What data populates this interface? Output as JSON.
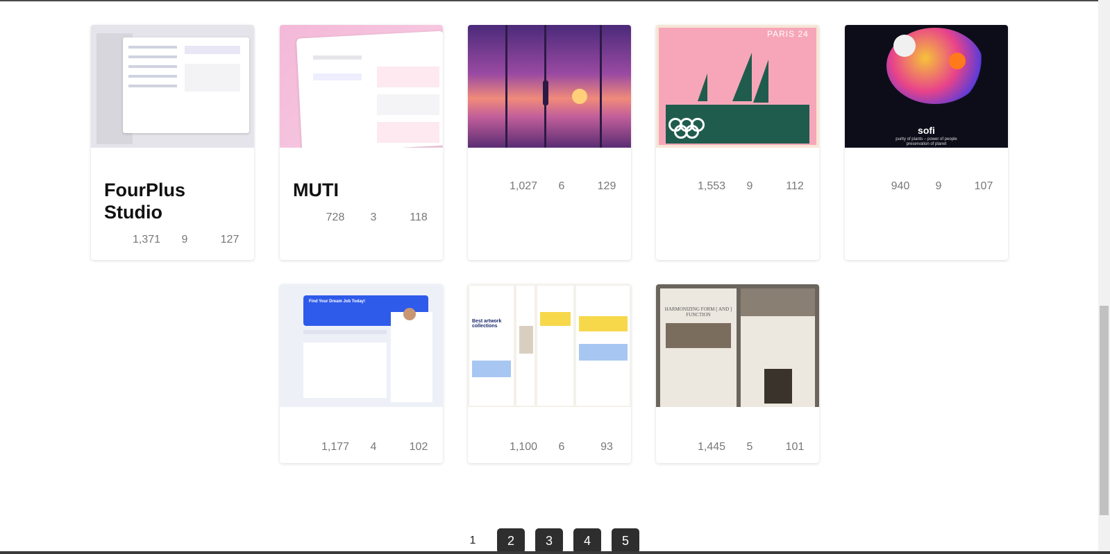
{
  "cards": [
    {
      "title": "FourPlus Studio",
      "views": "1,371",
      "comments": "9",
      "likes": "127"
    },
    {
      "title": "MUTI",
      "views": "728",
      "comments": "3",
      "likes": "118"
    },
    {
      "title": "",
      "views": "1,027",
      "comments": "6",
      "likes": "129"
    },
    {
      "title": "",
      "views": "1,553",
      "comments": "9",
      "likes": "112",
      "thumb_text": "PARIS 24"
    },
    {
      "title": "",
      "views": "940",
      "comments": "9",
      "likes": "107",
      "thumb_text": "sofi",
      "thumb_sub": "purity of plants – power of people",
      "thumb_sub2": "preservation of planet"
    },
    {
      "title": "",
      "views": "1,177",
      "comments": "4",
      "likes": "102",
      "thumb_text": "Find Your Dream Job Today!"
    },
    {
      "title": "",
      "views": "1,100",
      "comments": "6",
      "likes": "93",
      "thumb_text": "Best artwork collections"
    },
    {
      "title": "",
      "views": "1,445",
      "comments": "5",
      "likes": "101",
      "thumb_text": "HARMONIZING FORM [ AND ] FUNCTION"
    }
  ],
  "pagination": {
    "current": "1",
    "pages": [
      "2",
      "3",
      "4",
      "5"
    ]
  },
  "colors": {
    "button": "#2e2e2e",
    "stat_text": "#777777",
    "title": "#111111"
  }
}
